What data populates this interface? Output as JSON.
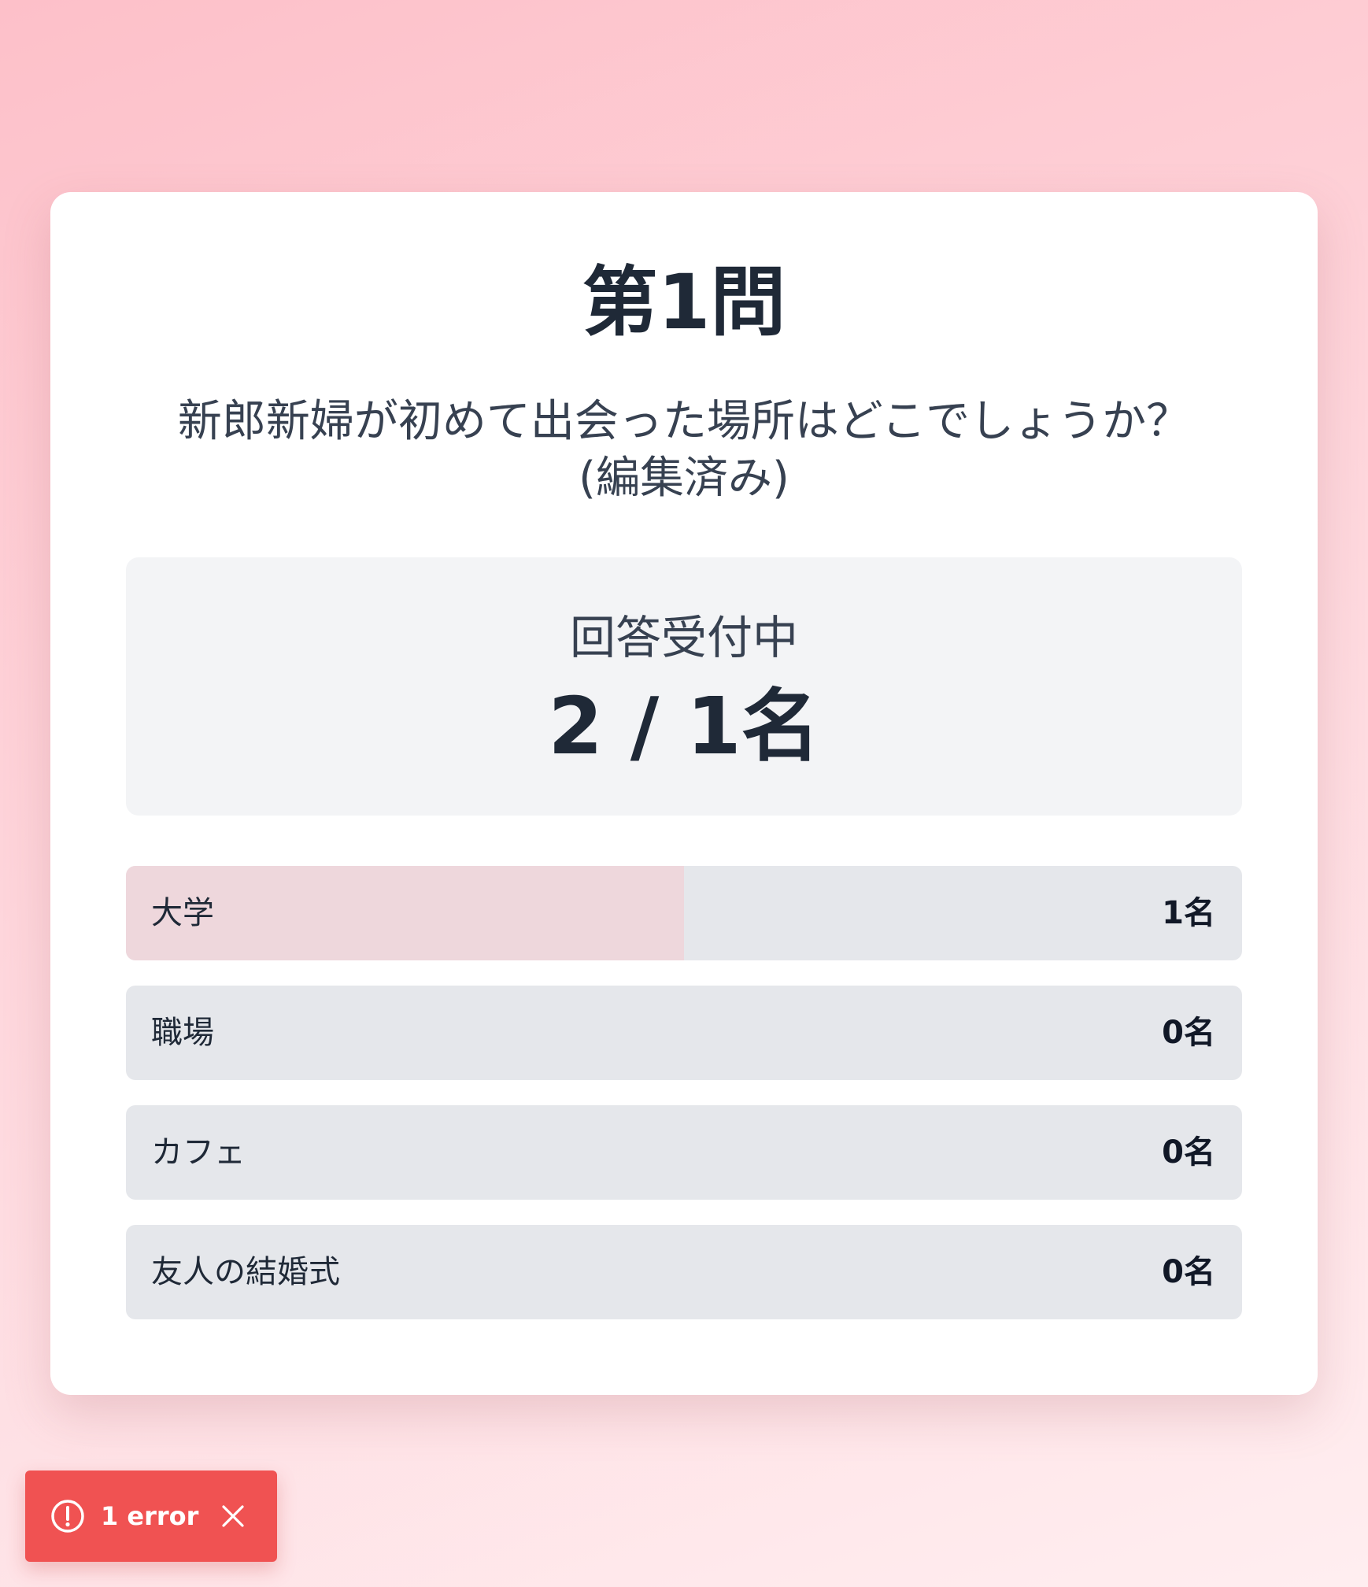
{
  "quiz": {
    "title": "第1問",
    "question_line1": "新郎新婦が初めて出会った場所はどこでしょうか？",
    "question_line2": "(編集済み)"
  },
  "status": {
    "label": "回答受付中",
    "count": "2 / 1名"
  },
  "options": [
    {
      "label": "大学",
      "count": "1名",
      "share": 0.5
    },
    {
      "label": "職場",
      "count": "0名",
      "share": 0
    },
    {
      "label": "カフェ",
      "count": "0名",
      "share": 0
    },
    {
      "label": "友人の結婚式",
      "count": "0名",
      "share": 0
    }
  ],
  "toast": {
    "text": "1 error",
    "icon": "alert-circle-icon",
    "close_icon": "close-icon"
  },
  "colors": {
    "toast_background": "#f05252",
    "bar_fill": "#eed7dc",
    "bar_track": "#e5e7eb",
    "status_background": "#f3f4f6"
  }
}
